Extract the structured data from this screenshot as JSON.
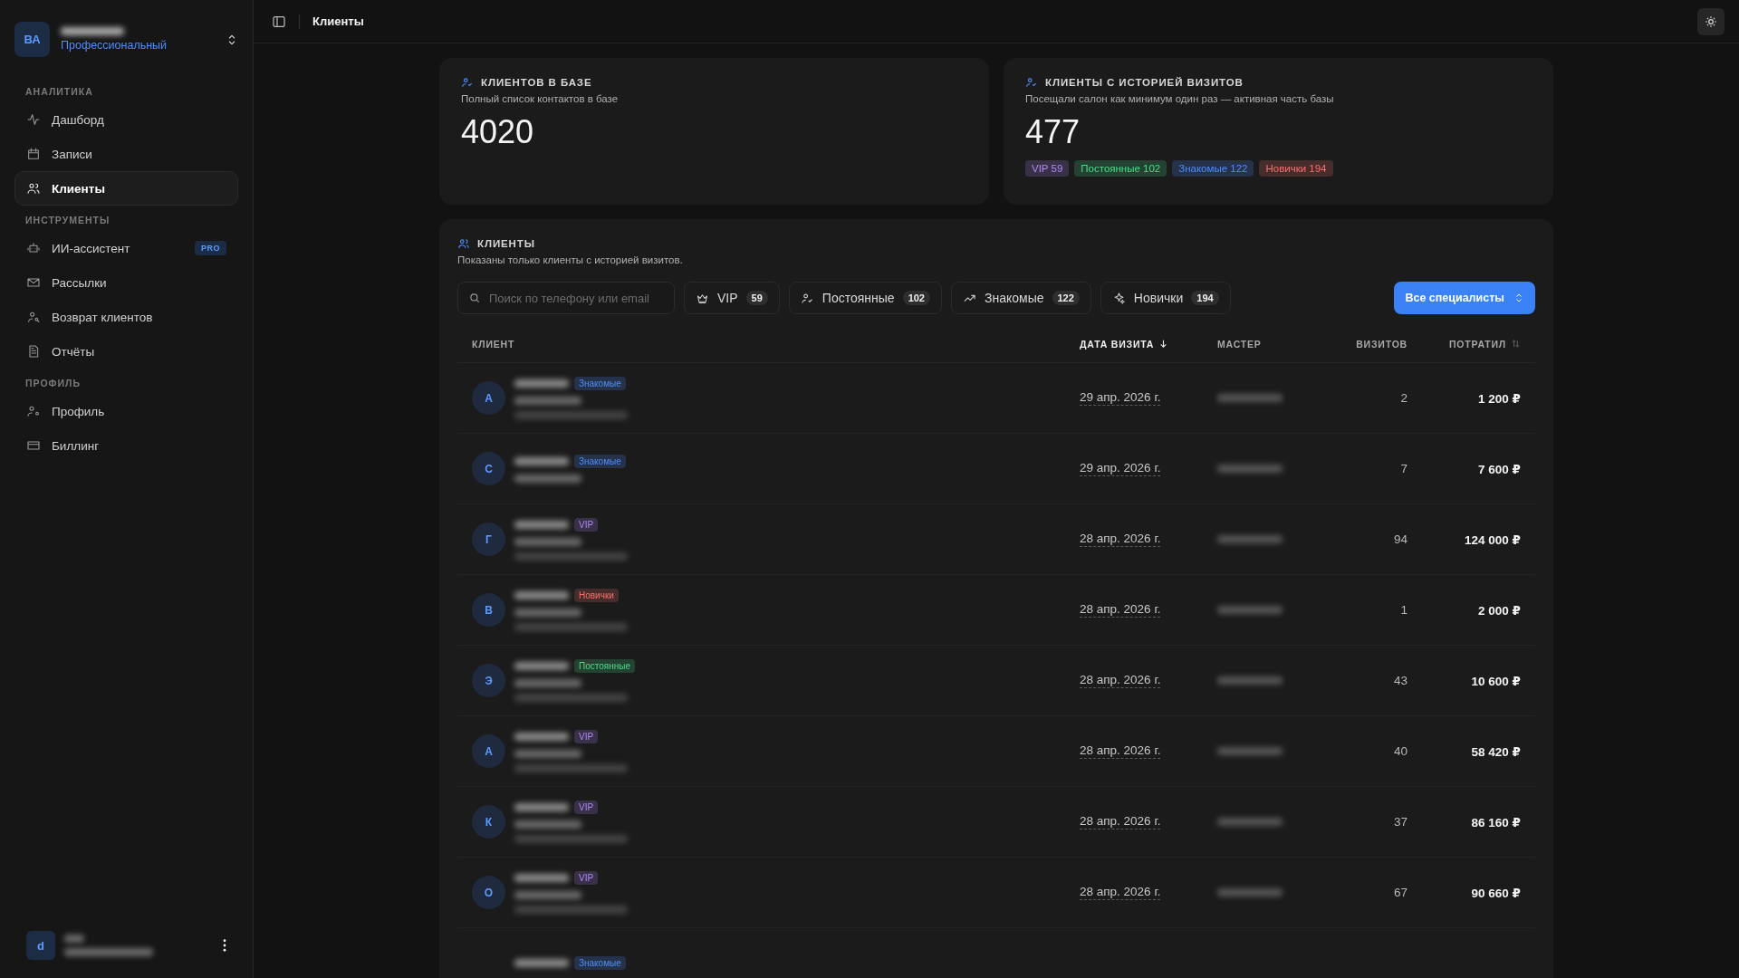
{
  "sidebar": {
    "workspace": {
      "initials": "ВА",
      "plan": "Профессиональный"
    },
    "sections": [
      {
        "title": "АНАЛИТИКА",
        "items": [
          {
            "label": "Дашборд",
            "selected": false
          },
          {
            "label": "Записи",
            "selected": false
          },
          {
            "label": "Клиенты",
            "selected": true
          }
        ]
      },
      {
        "title": "ИНСТРУМЕНТЫ",
        "items": [
          {
            "label": "ИИ-ассистент",
            "selected": false,
            "badge": "PRO"
          },
          {
            "label": "Рассылки",
            "selected": false
          },
          {
            "label": "Возврат клиентов",
            "selected": false
          },
          {
            "label": "Отчёты",
            "selected": false
          }
        ]
      },
      {
        "title": "ПРОФИЛЬ",
        "items": [
          {
            "label": "Профиль",
            "selected": false
          },
          {
            "label": "Биллинг",
            "selected": false
          }
        ]
      }
    ],
    "user": {
      "initial": "d"
    }
  },
  "header": {
    "title": "Клиенты"
  },
  "stats": [
    {
      "title": "КЛИЕНТОВ В БАЗЕ",
      "subtitle": "Полный список контактов в базе",
      "value": "4020"
    },
    {
      "title": "КЛИЕНТЫ С ИСТОРИЕЙ ВИЗИТОВ",
      "subtitle": "Посещали салон как минимум один раз — активная часть базы",
      "value": "477",
      "tags": [
        {
          "label": "VIP 59",
          "color": "#393147"
        },
        {
          "label": "Постоянные 102",
          "color": "#244231"
        },
        {
          "label": "Знакомые 122",
          "color": "#253249"
        },
        {
          "label": "Новички 194",
          "color": "#472c2c"
        }
      ]
    }
  ],
  "clients": {
    "title": "КЛИЕНТЫ",
    "subtitle": "Показаны только клиенты с историей визитов.",
    "search": {
      "placeholder": "Поиск по телефону или email"
    },
    "filters": [
      {
        "label": "VIP",
        "count": "59"
      },
      {
        "label": "Постоянные",
        "count": "102"
      },
      {
        "label": "Знакомые",
        "count": "122"
      },
      {
        "label": "Новички",
        "count": "194"
      }
    ],
    "specialists_button": "Все специалисты",
    "columns": [
      {
        "label": "КЛИЕНТ",
        "sorted": false,
        "sortable": false
      },
      {
        "label": "ДАТА ВИЗИТА",
        "sorted": true,
        "sortable": true
      },
      {
        "label": "МАСТЕР",
        "sorted": false,
        "sortable": false
      },
      {
        "label": "ВИЗИТОВ",
        "sorted": false,
        "sortable": false
      },
      {
        "label": "ПОТРАТИЛ",
        "sorted": false,
        "sortable": true
      }
    ],
    "rows": [
      {
        "initial": "А",
        "tag": {
          "label": "Знакомые",
          "color": "#253249"
        },
        "email_line": true,
        "date": "29 апр. 2026 г.",
        "visits": "2",
        "spent": "1 200 ₽"
      },
      {
        "initial": "С",
        "tag": {
          "label": "Знакомые",
          "color": "#253249"
        },
        "email_line": false,
        "date": "29 апр. 2026 г.",
        "visits": "7",
        "spent": "7 600 ₽"
      },
      {
        "initial": "Г",
        "tag": {
          "label": "VIP",
          "color": "#393147"
        },
        "email_line": true,
        "date": "28 апр. 2026 г.",
        "visits": "94",
        "spent": "124 000 ₽"
      },
      {
        "initial": "В",
        "tag": {
          "label": "Новички",
          "color": "#472c2c"
        },
        "email_line": true,
        "date": "28 апр. 2026 г.",
        "visits": "1",
        "spent": "2 000 ₽"
      },
      {
        "initial": "Э",
        "tag": {
          "label": "Постоянные",
          "color": "#244231"
        },
        "email_line": true,
        "date": "28 апр. 2026 г.",
        "visits": "43",
        "spent": "10 600 ₽"
      },
      {
        "initial": "А",
        "tag": {
          "label": "VIP",
          "color": "#393147"
        },
        "email_line": true,
        "date": "28 апр. 2026 г.",
        "visits": "40",
        "spent": "58 420 ₽"
      },
      {
        "initial": "К",
        "tag": {
          "label": "VIP",
          "color": "#393147"
        },
        "email_line": true,
        "date": "28 апр. 2026 г.",
        "visits": "37",
        "spent": "86 160 ₽"
      },
      {
        "initial": "О",
        "tag": {
          "label": "VIP",
          "color": "#393147"
        },
        "email_line": true,
        "date": "28 апр. 2026 г.",
        "visits": "67",
        "spent": "90 660 ₽"
      },
      {
        "tag": {
          "label": "Знакомые",
          "color": "#253249"
        }
      }
    ]
  }
}
